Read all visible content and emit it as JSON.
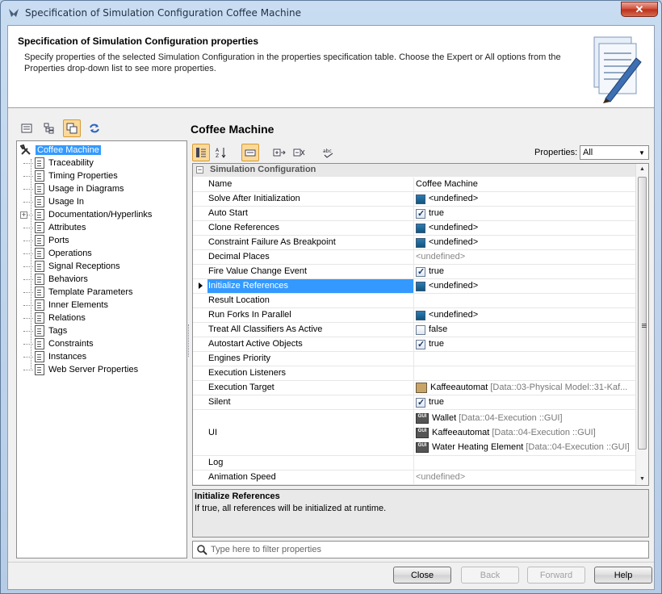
{
  "window": {
    "title": "Specification of Simulation Configuration Coffee Machine",
    "close_glyph": "✕"
  },
  "header": {
    "title": "Specification of Simulation Configuration properties",
    "description": "Specify properties of the selected Simulation Configuration in the properties specification table. Choose the Expert or All options from the Properties drop-down list to see more properties."
  },
  "tree": {
    "root": "Coffee Machine",
    "items": [
      "Traceability",
      "Timing Properties",
      "Usage in Diagrams",
      "Usage In",
      "Documentation/Hyperlinks",
      "Attributes",
      "Ports",
      "Operations",
      "Signal Receptions",
      "Behaviors",
      "Template Parameters",
      "Inner Elements",
      "Relations",
      "Tags",
      "Constraints",
      "Instances",
      "Web Server Properties"
    ]
  },
  "panel": {
    "title": "Coffee Machine",
    "properties_label": "Properties:",
    "properties_value": "All"
  },
  "grid": {
    "section": "Simulation Configuration",
    "rows": [
      {
        "name": "Name",
        "value": "Coffee Machine"
      },
      {
        "name": "Solve After Initialization",
        "value": "<undefined>"
      },
      {
        "name": "Auto Start",
        "value": "true"
      },
      {
        "name": "Clone References",
        "value": "<undefined>"
      },
      {
        "name": "Constraint Failure As Breakpoint",
        "value": "<undefined>"
      },
      {
        "name": "Decimal Places",
        "value": "<undefined>"
      },
      {
        "name": "Fire Value Change Event",
        "value": "true"
      },
      {
        "name": "Initialize References",
        "value": "<undefined>"
      },
      {
        "name": "Result Location",
        "value": ""
      },
      {
        "name": "Run Forks In Parallel",
        "value": "<undefined>"
      },
      {
        "name": "Treat All Classifiers As Active",
        "value": "false"
      },
      {
        "name": "Autostart Active Objects",
        "value": "true"
      },
      {
        "name": "Engines Priority",
        "value": ""
      },
      {
        "name": "Execution Listeners",
        "value": ""
      },
      {
        "name": "Execution Target",
        "value": "Kaffeeautomat",
        "path": "[Data::03-Physical Model::31-Kaf..."
      },
      {
        "name": "Silent",
        "value": "true"
      },
      {
        "name": "UI",
        "values": [
          {
            "value": "Wallet",
            "path": "[Data::04-Execution ::GUI]"
          },
          {
            "value": "Kaffeeautomat",
            "path": "[Data::04-Execution ::GUI]"
          },
          {
            "value": "Water Heating Element",
            "path": "[Data::04-Execution ::GUI]"
          }
        ]
      },
      {
        "name": "Log",
        "value": ""
      },
      {
        "name": "Animation Speed",
        "value": "<undefined>"
      }
    ],
    "gui_badge": "GUI"
  },
  "description": {
    "title": "Initialize References",
    "text": "If true, all references will be initialized at runtime."
  },
  "filter": {
    "placeholder": "Type here to filter properties"
  },
  "buttons": {
    "close": "Close",
    "back": "Back",
    "forward": "Forward",
    "help": "Help"
  }
}
